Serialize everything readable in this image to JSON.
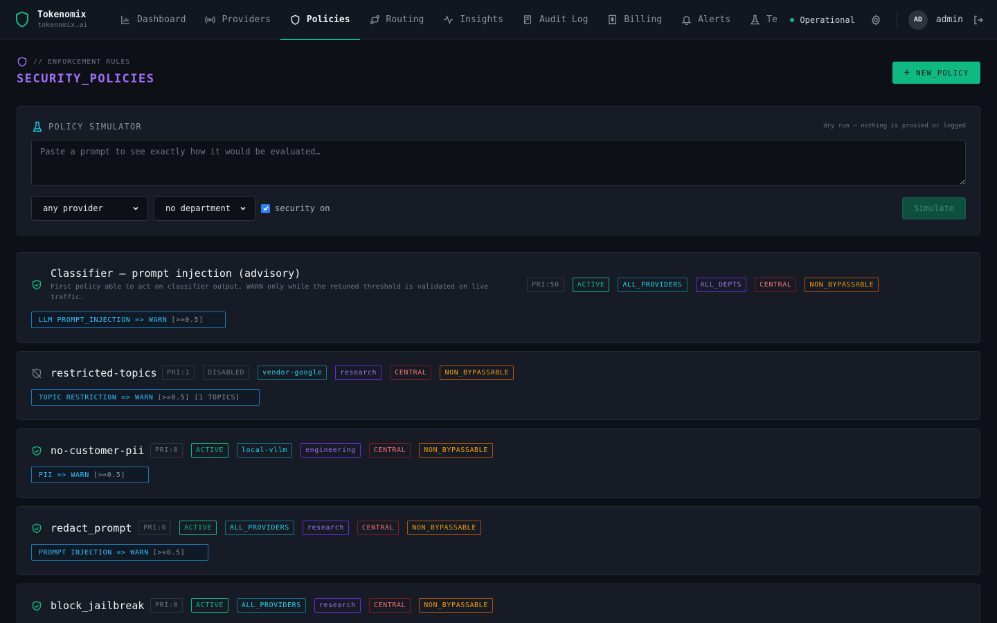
{
  "brand": {
    "name": "Tokenomix",
    "domain": "tokenomix.ai"
  },
  "nav": {
    "items": [
      {
        "label": "Dashboard",
        "icon": "bar-chart-icon"
      },
      {
        "label": "Providers",
        "icon": "broadcast-icon"
      },
      {
        "label": "Policies",
        "icon": "shield-icon",
        "active": true
      },
      {
        "label": "Routing",
        "icon": "route-icon"
      },
      {
        "label": "Insights",
        "icon": "activity-icon"
      },
      {
        "label": "Audit Log",
        "icon": "scroll-icon"
      },
      {
        "label": "Billing",
        "icon": "receipt-icon"
      },
      {
        "label": "Alerts",
        "icon": "bell-icon"
      },
      {
        "label": "Te",
        "icon": "flask-icon"
      }
    ],
    "status": "Operational",
    "avatar_initials": "AD",
    "user": "admin"
  },
  "header": {
    "crumb": "// ENFORCEMENT RULES",
    "title": "SECURITY_POLICIES",
    "new_button": "NEW_POLICY"
  },
  "simulator": {
    "title": "POLICY SIMULATOR",
    "note": "dry run — nothing is proxied or logged",
    "placeholder": "Paste a prompt to see exactly how it would be evaluated…",
    "provider": "any provider",
    "department": "no department",
    "security_label": "security on",
    "security_checked": true,
    "button": "Simulate"
  },
  "policies": [
    {
      "name": "Classifier — prompt injection (advisory)",
      "description": "First policy able to act on classifier output. WARN only while the retuned threshold is validated on live traffic.",
      "enabled": true,
      "priority": "PRI:50",
      "status": "ACTIVE",
      "provider": "ALL_PROVIDERS",
      "department": "ALL_DEPTS",
      "scope": "CENTRAL",
      "bypass": "NON_BYPASSABLE",
      "rule": "LLM PROMPT_INJECTION => WARN",
      "rule_detail": "[>=0.5]"
    },
    {
      "name": "restricted-topics",
      "enabled": false,
      "priority": "PRI:1",
      "status": "DISABLED",
      "provider": "vendor-google",
      "department": "research",
      "scope": "CENTRAL",
      "bypass": "NON_BYPASSABLE",
      "rule": "TOPIC RESTRICTION => WARN",
      "rule_detail": "[>=0.5] [1 TOPICS]"
    },
    {
      "name": "no-customer-pii",
      "enabled": true,
      "priority": "PRI:0",
      "status": "ACTIVE",
      "provider": "local-vllm",
      "department": "engineering",
      "scope": "CENTRAL",
      "bypass": "NON_BYPASSABLE",
      "rule": "PII => WARN",
      "rule_detail": "[>=0.5]"
    },
    {
      "name": "redact_prompt",
      "enabled": true,
      "priority": "PRI:0",
      "status": "ACTIVE",
      "provider": "ALL_PROVIDERS",
      "department": "research",
      "scope": "CENTRAL",
      "bypass": "NON_BYPASSABLE",
      "rule": "PROMPT INJECTION => WARN",
      "rule_detail": "[>=0.5]"
    },
    {
      "name": "block_jailbreak",
      "enabled": true,
      "priority": "PRI:0",
      "status": "ACTIVE",
      "provider": "ALL_PROVIDERS",
      "department": "research",
      "scope": "CENTRAL",
      "bypass": "NON_BYPASSABLE"
    }
  ],
  "colors": {
    "accent_green": "#10b981",
    "title_purple": "#a371f7",
    "provider_cyan": "#22d3ee",
    "scope_red": "#f87171",
    "bypass_amber": "#f59e0b"
  }
}
